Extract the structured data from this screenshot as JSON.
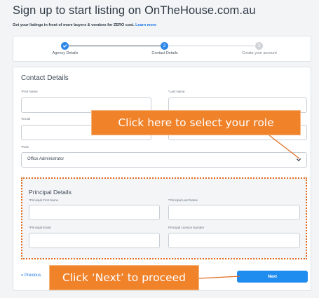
{
  "header": {
    "title": "Sign up to start listing on OnTheHouse.com.au",
    "subtitle": "Get your listings in front of more buyers & vendors for ZERO cost.",
    "learn_more": "Learn more"
  },
  "stepper": {
    "steps": [
      {
        "label": "Agency Details",
        "state": "complete"
      },
      {
        "label": "Contact Details",
        "state": "current",
        "number": "2"
      },
      {
        "label": "Create your account",
        "state": "upcoming",
        "number": "3"
      }
    ]
  },
  "contact": {
    "title": "Contact Details",
    "first_name_label": "*First Name",
    "last_name_label": "*Last Name",
    "email_label": "*Email",
    "role_label": "*Role",
    "role_value": "Office Administrator"
  },
  "principal": {
    "title": "Principal Details",
    "first_name_label": "*Principal First Name",
    "last_name_label": "*Principal Last Name",
    "email_label": "*Principal Email",
    "licence_label": "Principal Licence Number"
  },
  "footer": {
    "previous_label": "« Previous",
    "next_label": "Next"
  },
  "callouts": {
    "role": "Click here to select your role",
    "next": "Click ‘Next’ to proceed"
  },
  "colors": {
    "accent": "#1f8cf0",
    "callout": "#f0822a",
    "highlight_border": "#e36a1e"
  }
}
